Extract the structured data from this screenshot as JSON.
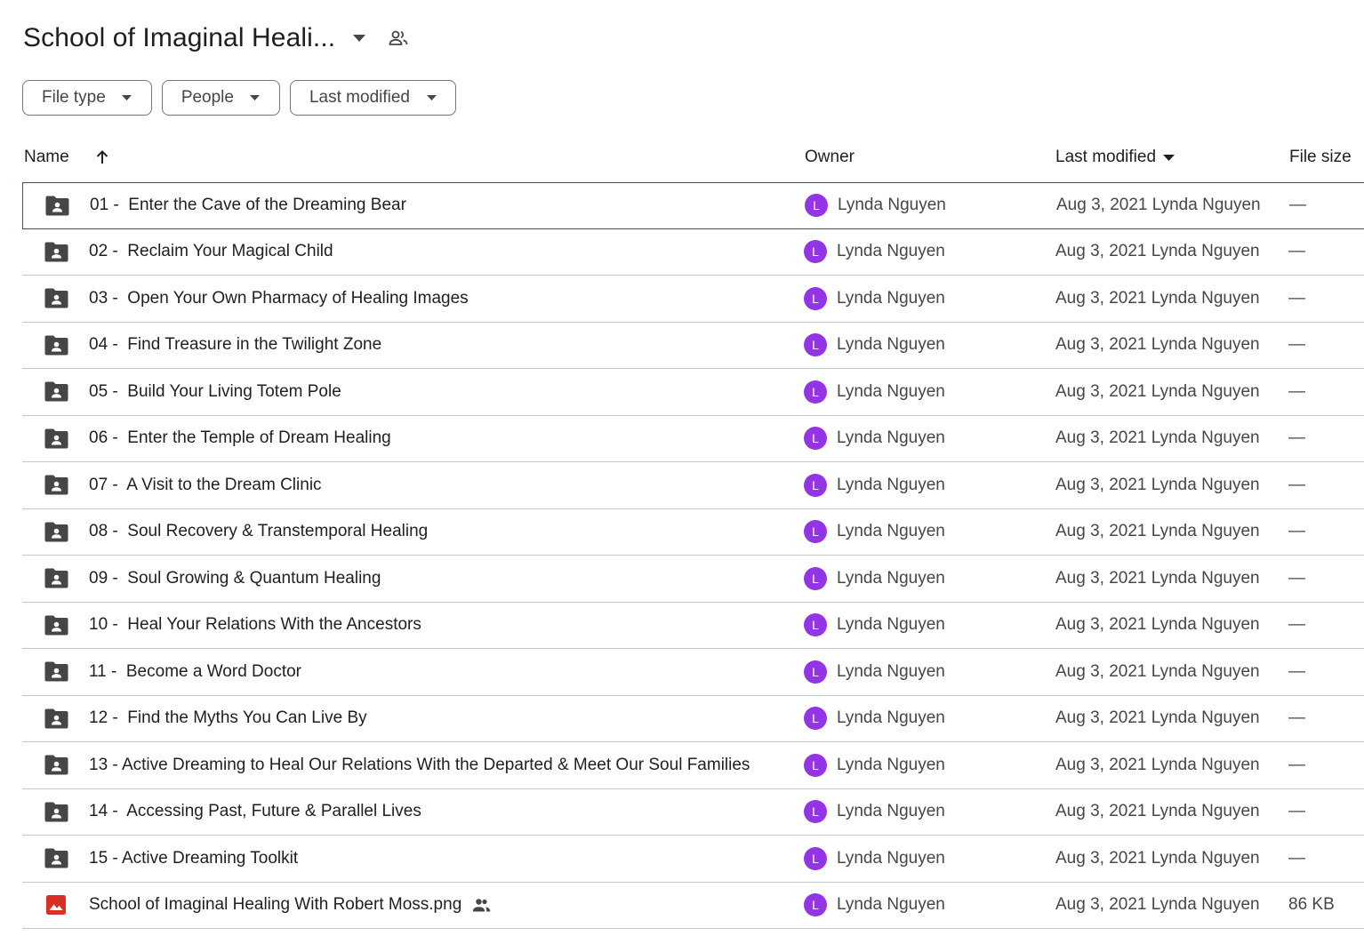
{
  "header": {
    "title": "School of Imaginal Heali..."
  },
  "filters": [
    {
      "label": "File type"
    },
    {
      "label": "People"
    },
    {
      "label": "Last modified"
    }
  ],
  "columns": {
    "name": "Name",
    "owner": "Owner",
    "modified": "Last modified",
    "size": "File size"
  },
  "colors": {
    "avatar": "#9334e6",
    "folder_icon": "#444746",
    "image_icon": "#d93025",
    "selection": "#0b57d0"
  },
  "rows": [
    {
      "icon": "shared-folder-icon",
      "name": "01 -  Enter the Cave of the Dreaming Bear",
      "avatar": "L",
      "owner": "Lynda Nguyen",
      "modified": "Aug 3, 2021 Lynda Nguyen",
      "size": "—"
    },
    {
      "icon": "shared-folder-icon",
      "name": "02 -  Reclaim Your Magical Child",
      "avatar": "L",
      "owner": "Lynda Nguyen",
      "modified": "Aug 3, 2021 Lynda Nguyen",
      "size": "—"
    },
    {
      "icon": "shared-folder-icon",
      "name": "03 -  Open Your Own Pharmacy of Healing Images",
      "avatar": "L",
      "owner": "Lynda Nguyen",
      "modified": "Aug 3, 2021 Lynda Nguyen",
      "size": "—"
    },
    {
      "icon": "shared-folder-icon",
      "name": "04 -  Find Treasure in the Twilight Zone",
      "avatar": "L",
      "owner": "Lynda Nguyen",
      "modified": "Aug 3, 2021 Lynda Nguyen",
      "size": "—"
    },
    {
      "icon": "shared-folder-icon",
      "name": "05 -  Build Your Living Totem Pole",
      "avatar": "L",
      "owner": "Lynda Nguyen",
      "modified": "Aug 3, 2021 Lynda Nguyen",
      "size": "—"
    },
    {
      "icon": "shared-folder-icon",
      "name": "06 -  Enter the Temple of Dream Healing",
      "avatar": "L",
      "owner": "Lynda Nguyen",
      "modified": "Aug 3, 2021 Lynda Nguyen",
      "size": "—"
    },
    {
      "icon": "shared-folder-icon",
      "name": "07 -  A Visit to the Dream Clinic",
      "avatar": "L",
      "owner": "Lynda Nguyen",
      "modified": "Aug 3, 2021 Lynda Nguyen",
      "size": "—"
    },
    {
      "icon": "shared-folder-icon",
      "name": "08 -  Soul Recovery & Transtemporal Healing",
      "avatar": "L",
      "owner": "Lynda Nguyen",
      "modified": "Aug 3, 2021 Lynda Nguyen",
      "size": "—"
    },
    {
      "icon": "shared-folder-icon",
      "name": "09 -  Soul Growing & Quantum Healing",
      "avatar": "L",
      "owner": "Lynda Nguyen",
      "modified": "Aug 3, 2021 Lynda Nguyen",
      "size": "—"
    },
    {
      "icon": "shared-folder-icon",
      "name": "10 -  Heal Your Relations With the Ancestors",
      "avatar": "L",
      "owner": "Lynda Nguyen",
      "modified": "Aug 3, 2021 Lynda Nguyen",
      "size": "—"
    },
    {
      "icon": "shared-folder-icon",
      "name": "11 -  Become a Word Doctor",
      "avatar": "L",
      "owner": "Lynda Nguyen",
      "modified": "Aug 3, 2021 Lynda Nguyen",
      "size": "—"
    },
    {
      "icon": "shared-folder-icon",
      "name": "12 -  Find the Myths You Can Live By",
      "avatar": "L",
      "owner": "Lynda Nguyen",
      "modified": "Aug 3, 2021 Lynda Nguyen",
      "size": "—"
    },
    {
      "icon": "shared-folder-icon",
      "name": "13 - Active Dreaming to Heal Our Relations With the Departed & Meet Our Soul Families",
      "avatar": "L",
      "owner": "Lynda Nguyen",
      "modified": "Aug 3, 2021 Lynda Nguyen",
      "size": "—"
    },
    {
      "icon": "shared-folder-icon",
      "name": "14 -  Accessing Past, Future & Parallel Lives",
      "avatar": "L",
      "owner": "Lynda Nguyen",
      "modified": "Aug 3, 2021 Lynda Nguyen",
      "size": "—"
    },
    {
      "icon": "shared-folder-icon",
      "name": "15 - Active Dreaming Toolkit",
      "avatar": "L",
      "owner": "Lynda Nguyen",
      "modified": "Aug 3, 2021 Lynda Nguyen",
      "size": "—"
    },
    {
      "icon": "image-file-icon",
      "name": "School of Imaginal Healing With Robert Moss.png",
      "shared": true,
      "avatar": "L",
      "owner": "Lynda Nguyen",
      "modified": "Aug 3, 2021 Lynda Nguyen",
      "size": "86 KB"
    }
  ]
}
